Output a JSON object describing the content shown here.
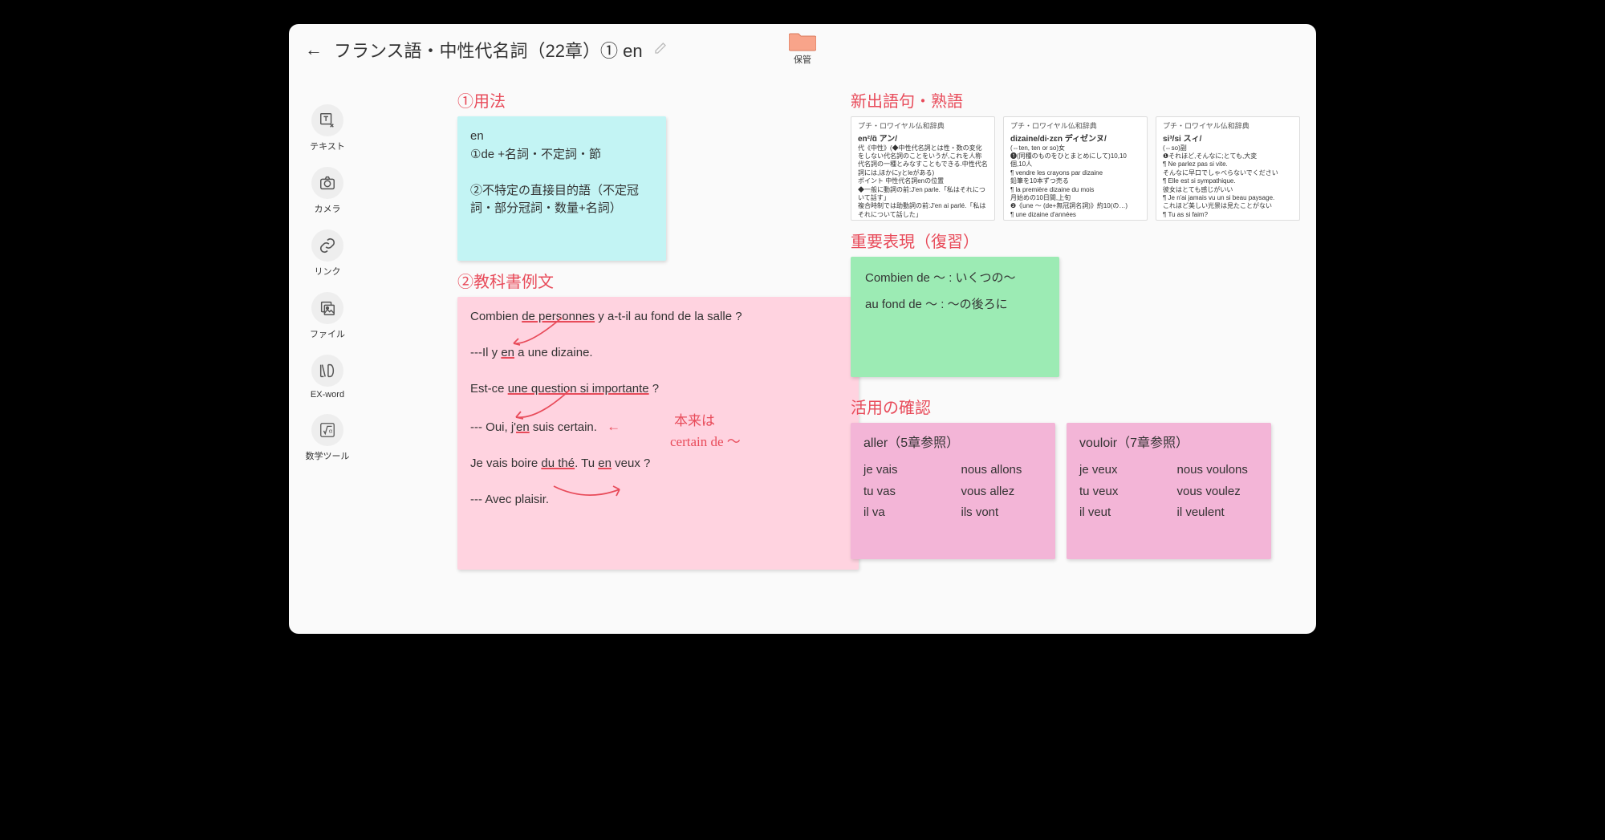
{
  "header": {
    "title": "フランス語・中性代名詞（22章）① en",
    "folder_label": "保管"
  },
  "sidebar": {
    "tools": [
      {
        "id": "text",
        "label": "テキスト"
      },
      {
        "id": "camera",
        "label": "カメラ"
      },
      {
        "id": "link",
        "label": "リンク"
      },
      {
        "id": "file",
        "label": "ファイル"
      },
      {
        "id": "exword",
        "label": "EX-word"
      },
      {
        "id": "math",
        "label": "数学ツール"
      }
    ]
  },
  "sections": {
    "usage_title": "①用法",
    "usage_card": {
      "line1": "en",
      "line2": "①de +名詞・不定詞・節",
      "line3": "②不特定の直接目的語（不定冠詞・部分冠詞・数量+名詞）"
    },
    "textbook_title": "②教科書例文",
    "textbook_card": {
      "q1a": "Combien ",
      "q1b": "de personnes",
      "q1c": " y a-t-il au fond de la salle ?",
      "a1a": "---Il y ",
      "a1b": "en",
      "a1c": " a une dizaine.",
      "q2a": "Est-ce ",
      "q2b": "une question si importante",
      "q2c": " ?",
      "a2a": "--- Oui, j'",
      "a2b": "en",
      "a2c": " suis certain.",
      "note1": "本来は",
      "note2": "certain de ～",
      "q3a": "Je vais boire ",
      "q3b": "du thé",
      "q3c": ". Tu ",
      "q3d": "en",
      "q3e": " veux ?",
      "a3": "--- Avec plaisir."
    },
    "vocab_title": "新出語句・熟語",
    "dict": [
      {
        "src": "プチ・ロワイヤル仏和辞典",
        "head": "en²/ɑ̃ アン/",
        "body": "代《中性》(◆中性代名詞とは性・数の変化をしない代名詞のことをいうが,これを人称代名詞の一種とみなすこともできる.中性代名詞には,ほかにyとleがある)\nポイント 中性代名詞enの位置\n◆一般に動詞の前:J'en parle.「私はそれについて話す」\n複合時制では助動詞の前:J'en ai parlé.「私はそれについて話した」"
      },
      {
        "src": "プチ・ロワイヤル仏和辞典",
        "head": "dizaine/di·zɛn ディゼンヌ/",
        "body": "(⇔ten, ten or so)女\n❶(同種のものをひとまとめにして)10,10個,10人\n¶ vendre les crayons par dizaine\n 鉛筆を10本ずつ売る\n¶ la première dizaine du mois\n 月始めの10日間,上旬\n❷《une ～ (de+無冠詞名詞)》約10(の…)\n¶ une dizaine d'années"
      },
      {
        "src": "プチ・ロワイヤル仏和辞典",
        "head": "si³/si スィ/",
        "body": "(⇔so)副\n❶それほど,そんなに;とても,大変\n¶ Ne parlez pas si vite.\n そんなに早口でしゃべらないでください\n¶ Elle est si sympathique.\n 彼女はとても感じがいい\n¶ Je n'ai jamais vu un si beau paysage.\n これほど美しい光景は見たことがない\n¶ Tu as si faim?"
      }
    ],
    "review_title": "重要表現（復習）",
    "review_card": {
      "line1": "Combien de ～ : いくつの～",
      "line2": "au fond de ～ : ～の後ろに"
    },
    "conj_title": "活用の確認",
    "conj": [
      {
        "title": "aller（5章参照）",
        "cells": [
          "je vais",
          "nous allons",
          "tu vas",
          "vous allez",
          "il va",
          "ils vont"
        ]
      },
      {
        "title": "vouloir（7章参照）",
        "cells": [
          "je veux",
          "nous voulons",
          "tu veux",
          "vous voulez",
          "il veut",
          "il veulent"
        ]
      }
    ]
  }
}
